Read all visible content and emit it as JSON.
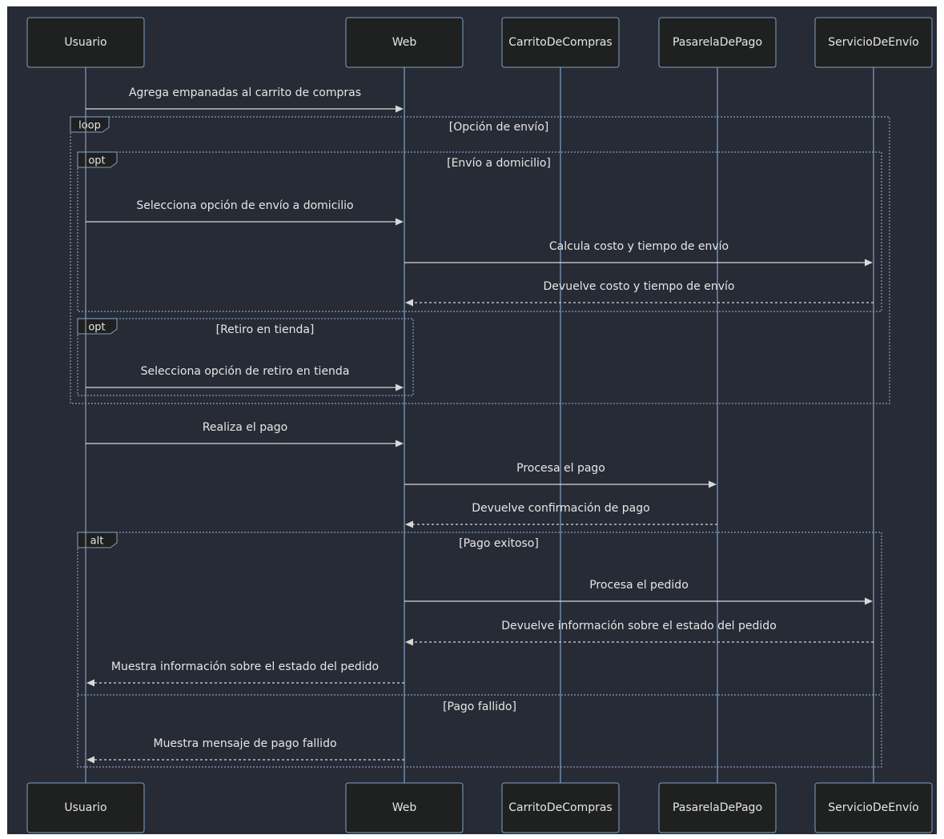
{
  "participants": [
    {
      "id": "usuario",
      "label": "Usuario"
    },
    {
      "id": "web",
      "label": "Web"
    },
    {
      "id": "carrito",
      "label": "CarritoDeCompras"
    },
    {
      "id": "pasarela",
      "label": "PasarelaDePago"
    },
    {
      "id": "envio",
      "label": "ServicioDeEnvío"
    }
  ],
  "messages": [
    {
      "from": "usuario",
      "to": "web",
      "text": "Agrega empanadas al carrito de compras",
      "style": "solid"
    },
    {
      "from": "usuario",
      "to": "web",
      "text": "Selecciona opción de envío a domicilio",
      "style": "solid"
    },
    {
      "from": "web",
      "to": "envio",
      "text": "Calcula costo y tiempo de envío",
      "style": "solid"
    },
    {
      "from": "envio",
      "to": "web",
      "text": "Devuelve costo y tiempo de envío",
      "style": "dashed"
    },
    {
      "from": "usuario",
      "to": "web",
      "text": "Selecciona opción de retiro en tienda",
      "style": "solid"
    },
    {
      "from": "usuario",
      "to": "web",
      "text": "Realiza el pago",
      "style": "solid"
    },
    {
      "from": "web",
      "to": "pasarela",
      "text": "Procesa el pago",
      "style": "solid"
    },
    {
      "from": "pasarela",
      "to": "web",
      "text": "Devuelve confirmación de pago",
      "style": "dashed"
    },
    {
      "from": "web",
      "to": "envio",
      "text": "Procesa el pedido",
      "style": "solid"
    },
    {
      "from": "envio",
      "to": "web",
      "text": "Devuelve información sobre el estado del pedido",
      "style": "dashed"
    },
    {
      "from": "web",
      "to": "usuario",
      "text": "Muestra información sobre el estado del pedido",
      "style": "dashed"
    },
    {
      "from": "web",
      "to": "usuario",
      "text": "Muestra mensaje de pago fallido",
      "style": "dashed"
    }
  ],
  "fragments": [
    {
      "kind": "loop",
      "condition": "[Opción de envío]"
    },
    {
      "kind": "opt",
      "condition": "[Envío a domicilio]"
    },
    {
      "kind": "opt",
      "condition": "[Retiro en tienda]"
    },
    {
      "kind": "alt",
      "condition": "[Pago exitoso]",
      "else_condition": "[Pago fallido]"
    }
  ],
  "colors": {
    "background": "#272b36",
    "actor_fill": "#1f2020",
    "lifeline": "#81a1c1",
    "message": "#d8d8d8",
    "text": "#e6e6e6"
  }
}
